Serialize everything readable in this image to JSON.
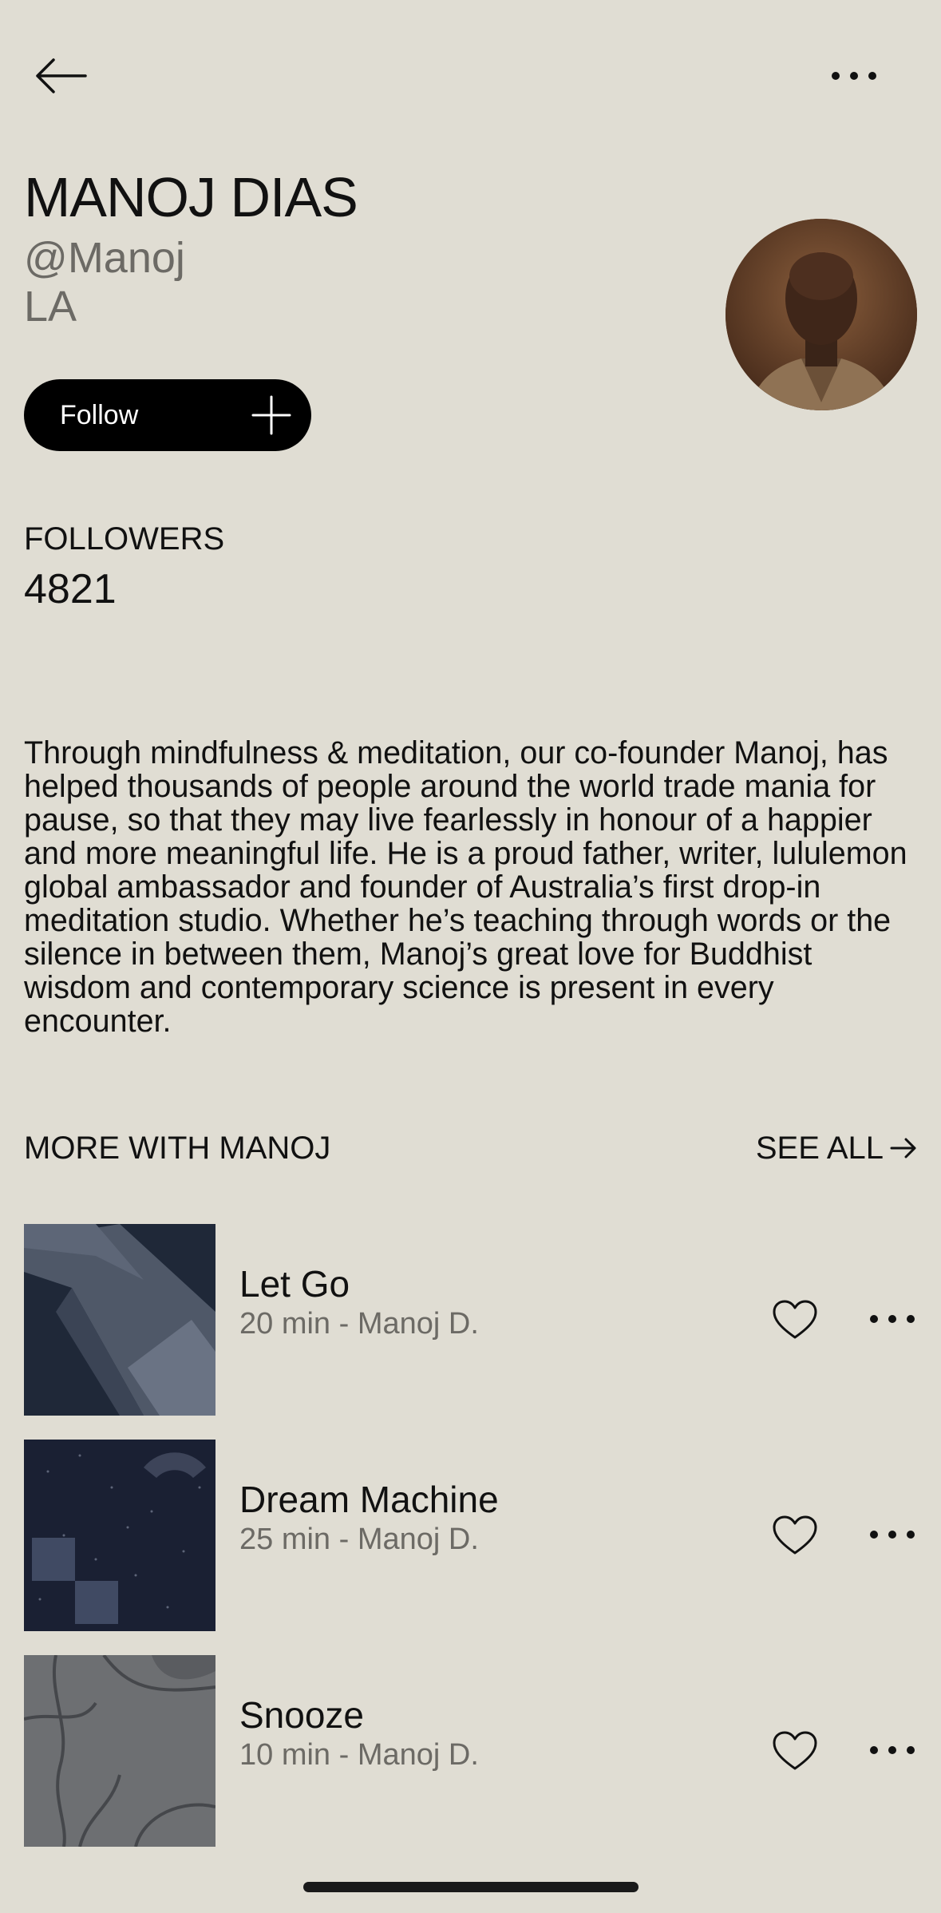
{
  "nav": {
    "back_icon": "arrow-left-icon",
    "more_icon": "ellipsis-icon"
  },
  "profile": {
    "name": "MANOJ DIAS",
    "handle": "@Manoj",
    "location": "LA",
    "follow_label": "Follow",
    "follow_icon": "plus-icon",
    "followers_label": "FOLLOWERS",
    "followers_count": "4821",
    "bio": "Through mindfulness & meditation, our co-founder Manoj, has helped thousands of people around the world trade mania for pause, so that they may live fearlessly in honour of a happier and more meaningful life. He is a proud father, writer, lululemon global ambassador and founder of Australia’s first drop-in meditation studio. Whether he’s teaching through words or the silence in between them, Manoj’s great love for Buddhist wisdom and contemporary science is present in every encounter."
  },
  "more": {
    "title": "MORE WITH MANOJ",
    "see_all": "SEE ALL",
    "items": [
      {
        "title": "Let Go",
        "subtitle": "20 min - Manoj D."
      },
      {
        "title": "Dream Machine",
        "subtitle": "25 min - Manoj D."
      },
      {
        "title": "Snooze",
        "subtitle": "10 min - Manoj D."
      }
    ]
  },
  "colors": {
    "background": "#e0ddd3",
    "text": "#111111",
    "muted": "#6c6a65",
    "button": "#000000"
  }
}
